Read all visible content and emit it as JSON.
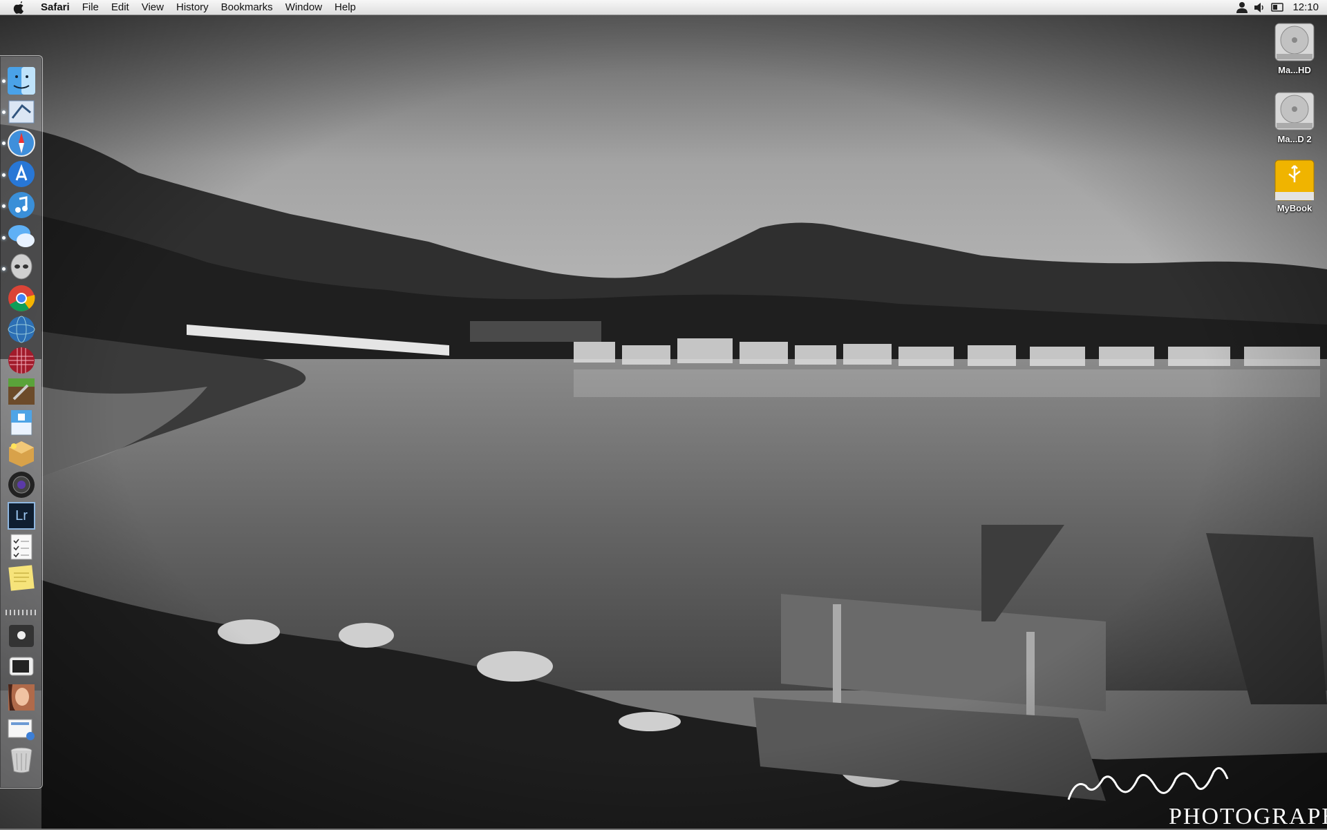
{
  "menubar": {
    "app_name": "Safari",
    "items": [
      "File",
      "Edit",
      "View",
      "History",
      "Bookmarks",
      "Window",
      "Help"
    ],
    "status_icons": [
      "user-icon",
      "volume-icon",
      "battery-icon"
    ],
    "clock": "12:10"
  },
  "dock": {
    "apps": [
      {
        "name": "Finder",
        "icon": "finder-icon",
        "running": true
      },
      {
        "name": "Mail",
        "icon": "mail-icon",
        "running": true
      },
      {
        "name": "Safari",
        "icon": "safari-icon",
        "running": true
      },
      {
        "name": "App Store",
        "icon": "app-store-icon",
        "running": true
      },
      {
        "name": "iTunes",
        "icon": "itunes-icon",
        "running": true
      },
      {
        "name": "Messages",
        "icon": "messages-icon",
        "running": true
      },
      {
        "name": "Alien",
        "icon": "alien-app-icon",
        "running": true
      },
      {
        "name": "Chrome",
        "icon": "chrome-icon",
        "running": false
      },
      {
        "name": "Globe",
        "icon": "globe-app-icon",
        "running": false
      },
      {
        "name": "Grid",
        "icon": "grid-app-icon",
        "running": false
      },
      {
        "name": "Minecraft",
        "icon": "minecraft-icon",
        "running": false
      },
      {
        "name": "Preview",
        "icon": "book-app-icon",
        "running": false
      },
      {
        "name": "Box",
        "icon": "box-app-icon",
        "running": false
      },
      {
        "name": "Photo Booth",
        "icon": "camera-lens-icon",
        "running": false
      },
      {
        "name": "Lightroom",
        "icon": "lightroom-icon",
        "label": "Lr",
        "running": false
      },
      {
        "name": "Reminders",
        "icon": "checklist-icon",
        "running": false
      },
      {
        "name": "Stickies",
        "icon": "sticky-note-icon",
        "running": false
      }
    ],
    "stack": [
      {
        "name": "Apple Folder",
        "icon": "apple-folder-icon"
      },
      {
        "name": "Device",
        "icon": "phone-icon"
      },
      {
        "name": "Photo",
        "icon": "portrait-icon"
      },
      {
        "name": "Downloads",
        "icon": "document-stack-icon"
      },
      {
        "name": "Trash",
        "icon": "trash-icon"
      }
    ]
  },
  "desktop": {
    "icons": [
      {
        "label": "Ma...HD",
        "icon": "hard-drive-icon"
      },
      {
        "label": "Ma...D 2",
        "icon": "hard-drive-icon"
      },
      {
        "label": "MyBook",
        "icon": "usb-drive-icon"
      }
    ]
  },
  "wallpaper": {
    "watermark_script": "jeremy blake",
    "watermark_text": "PHOTOGRAPH",
    "description_colors": {
      "sky": "#9a9a9a",
      "hills": "#2a2a2a",
      "water": "#6e6e6e"
    }
  }
}
